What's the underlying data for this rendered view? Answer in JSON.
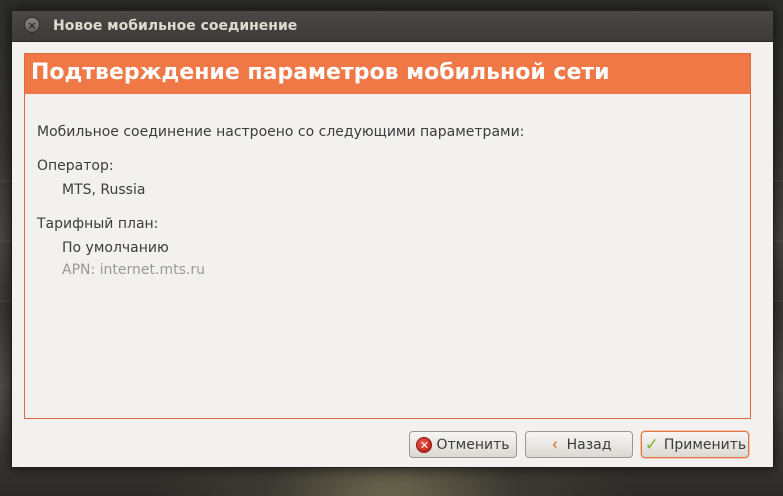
{
  "window": {
    "title": "Новое мобильное соединение",
    "close_glyph": "×"
  },
  "header": {
    "title": "Подтверждение параметров мобильной сети"
  },
  "body": {
    "intro": "Мобильное соединение настроено со следующими параметрами:",
    "provider_label": "Оператор:",
    "provider_value": "MTS, Russia",
    "plan_label": "Тарифный план:",
    "plan_value": "По умолчанию",
    "apn_line": "APN: internet.mts.ru"
  },
  "buttons": {
    "cancel_label": "Отменить",
    "back_label": "Назад",
    "apply_label": "Применить"
  },
  "icons": {
    "close": "close-icon",
    "cancel": "cancel-icon",
    "back": "back-arrow-icon",
    "apply": "checkmark-icon"
  },
  "colors": {
    "accent_orange": "#f07746",
    "window_bg": "#f2f1f0",
    "titlebar": "#3c3b37"
  }
}
